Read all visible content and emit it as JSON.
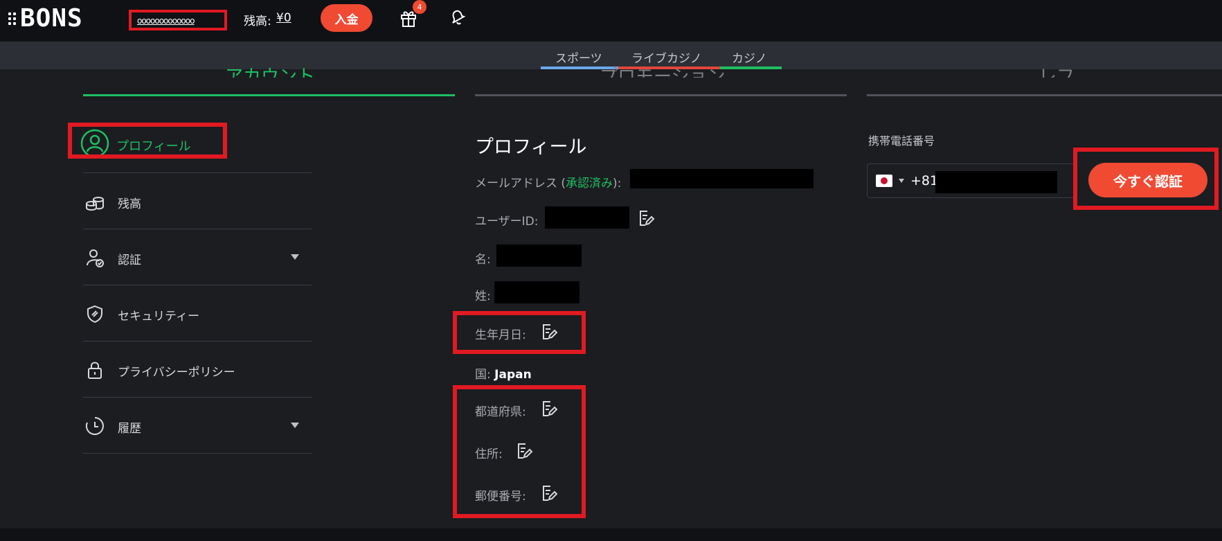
{
  "header": {
    "logo": "BONS",
    "username": "ooooooooooooo",
    "balance_label": "残高:",
    "balance_value": "¥0",
    "deposit_label": "入金",
    "gift_badge": "4",
    "accent": "#f04a32"
  },
  "categories": [
    {
      "label": "スポーツ",
      "color": "#6aa9e9"
    },
    {
      "label": "ライブカジノ",
      "color": "#e2463c"
    },
    {
      "label": "カジノ",
      "color": "#1fbf62"
    }
  ],
  "sections": {
    "account": "アカウント",
    "promotions": "プロモーション",
    "third": "レフ"
  },
  "sidebar": {
    "items": [
      {
        "label": "プロフィール",
        "icon": "user-icon",
        "active": true
      },
      {
        "label": "残高",
        "icon": "coins-icon"
      },
      {
        "label": "認証",
        "icon": "user-check-icon"
      },
      {
        "label": "セキュリティー",
        "icon": "shield-icon"
      },
      {
        "label": "プライバシーポリシー",
        "icon": "lock-icon"
      },
      {
        "label": "履歴",
        "icon": "history-icon"
      }
    ]
  },
  "profile": {
    "heading": "プロフィール",
    "email_label": "メールアドレス (",
    "email_verified": "承認済み",
    "email_suffix": "):",
    "userid_label": "ユーザーID:",
    "first_name_label": "名:",
    "last_name_label": "姓:",
    "birthdate_label": "生年月日:",
    "country_label": "国:",
    "country_value": "Japan",
    "prefecture_label": "都道府県:",
    "address_label": "住所:",
    "postal_label": "郵便番号:"
  },
  "phone": {
    "label": "携帯電話番号",
    "code": "+81",
    "verify_label": "今すぐ認証"
  }
}
